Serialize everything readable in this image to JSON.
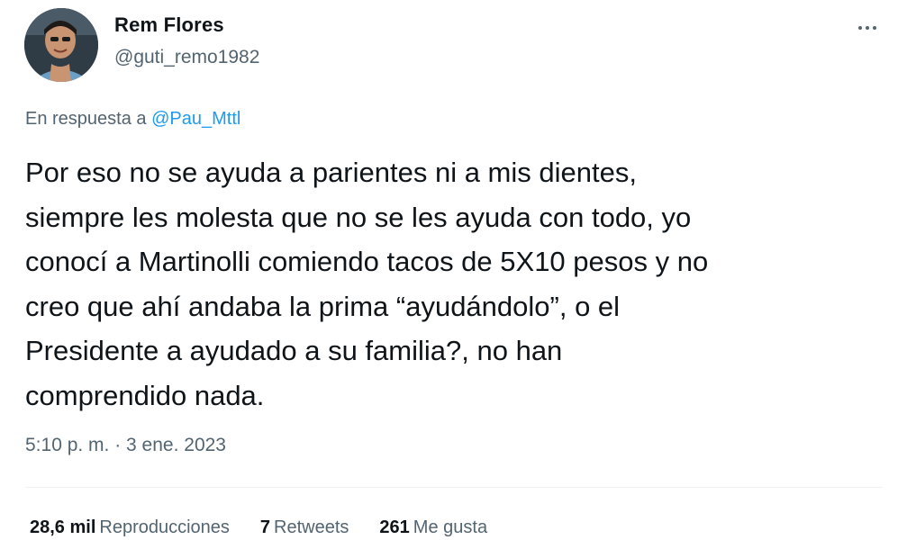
{
  "author": {
    "display_name": "Rem Flores",
    "handle": "@guti_remo1982"
  },
  "reply": {
    "prefix": "En respuesta a",
    "mention": "@Pau_Mttl"
  },
  "tweet": {
    "text": "Por eso no se ayuda a parientes ni a mis dientes,\nsiempre les molesta que no se les ayuda con todo, yo\nconocí a Martinolli comiendo tacos de 5X10 pesos y no\ncreo que ahí andaba la prima “ayudándolo”, o el\nPresidente a ayudado a su familia?, no han\ncomprendido nada."
  },
  "timestamp": "5:10 p. m. · 3 ene. 2023",
  "stats": {
    "views_count": "28,6 mil",
    "views_label": "Reproducciones",
    "retweets_count": "7",
    "retweets_label": "Retweets",
    "likes_count": "261",
    "likes_label": "Me gusta"
  },
  "icons": {
    "more": "more-options-icon",
    "avatar": "profile-photo"
  },
  "colors": {
    "text_primary": "#0f1419",
    "text_secondary": "#536471",
    "link": "#1d9bf0",
    "divider": "#eff3f4"
  }
}
